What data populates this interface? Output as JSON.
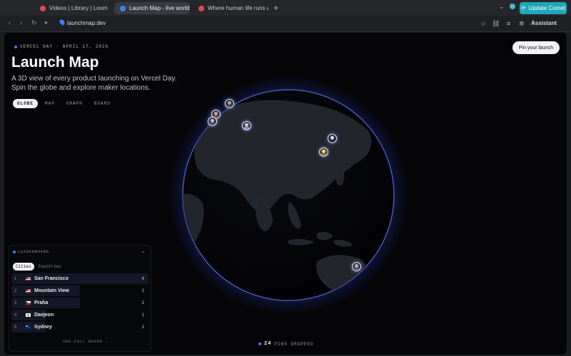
{
  "browser": {
    "tabs": [
      {
        "label": "Videos | Library | Loom",
        "favicon_color": "#e5484d"
      },
      {
        "label": "Launch Map - live world ma",
        "favicon_color": "#3b82f6"
      },
      {
        "label": "Where human life runs with",
        "favicon_color": "#e5484d"
      }
    ],
    "new_tab_glyph": "+",
    "update_label": "Update Comet",
    "url": "launchmap.dev",
    "assistant_label": "Assistant"
  },
  "page": {
    "date_badge": "VERCEL DAY · APRIL 17, 2026",
    "title": "Launch Map",
    "subtitle": "A 3D view of every product launching on Vercel Day. Spin the globe and explore maker locations.",
    "view_tabs": [
      "GLOBE",
      "MAP",
      "GRAPH",
      "BOARD"
    ],
    "active_view": "GLOBE",
    "pin_button": "Pin your launch"
  },
  "leaderboard": {
    "heading": "LEADERBOARD",
    "tabs": [
      "Cities",
      "Countries"
    ],
    "active_tab": "Cities",
    "rows": [
      {
        "rank": "1",
        "name": "San Francisco",
        "count": "4"
      },
      {
        "rank": "2",
        "name": "Mountain View",
        "count": "2"
      },
      {
        "rank": "3",
        "name": "Praha",
        "count": "2"
      },
      {
        "rank": "4",
        "name": "Daejeon",
        "count": "1"
      },
      {
        "rank": "5",
        "name": "Sydney",
        "count": "1"
      }
    ],
    "see_full_board": "SEE FULL BOARD →"
  },
  "footer": {
    "pins_count": "24",
    "pins_label": "PINS DROPPED"
  },
  "colors": {
    "accent": "#3b82f6",
    "update_button": "#20a7b9",
    "globe_glow": "#3c5aff"
  }
}
